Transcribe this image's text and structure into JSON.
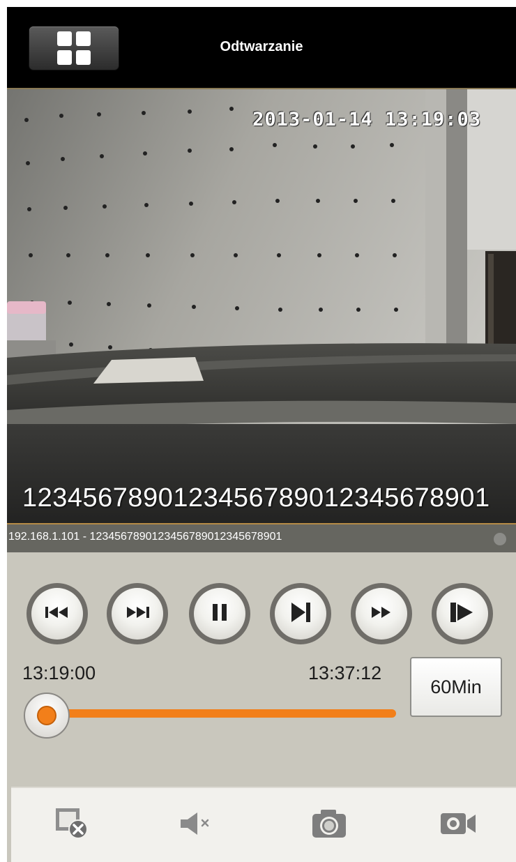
{
  "header": {
    "title": "Odtwarzanie",
    "menu_icon": "grid-icon"
  },
  "video": {
    "osd_datetime": "2013-01-14 13:19:03",
    "osd_camera_name": "1234567890123456789012345678901"
  },
  "info_bar": {
    "source": "192.168.1.101 - 1234567890123456789012345678901"
  },
  "controls": {
    "buttons": [
      {
        "name": "skip-back-icon"
      },
      {
        "name": "skip-forward-icon"
      },
      {
        "name": "pause-icon"
      },
      {
        "name": "step-frame-icon"
      },
      {
        "name": "fast-forward-icon"
      },
      {
        "name": "play-slow-icon"
      }
    ],
    "start_time": "13:19:00",
    "end_time": "13:37:12",
    "range_label": "60Min",
    "progress": 0.0,
    "accent_color": "#f27f1a"
  },
  "toolbar": {
    "items": [
      {
        "name": "close-playback-icon"
      },
      {
        "name": "mute-icon"
      },
      {
        "name": "snapshot-icon"
      },
      {
        "name": "record-icon"
      }
    ]
  }
}
